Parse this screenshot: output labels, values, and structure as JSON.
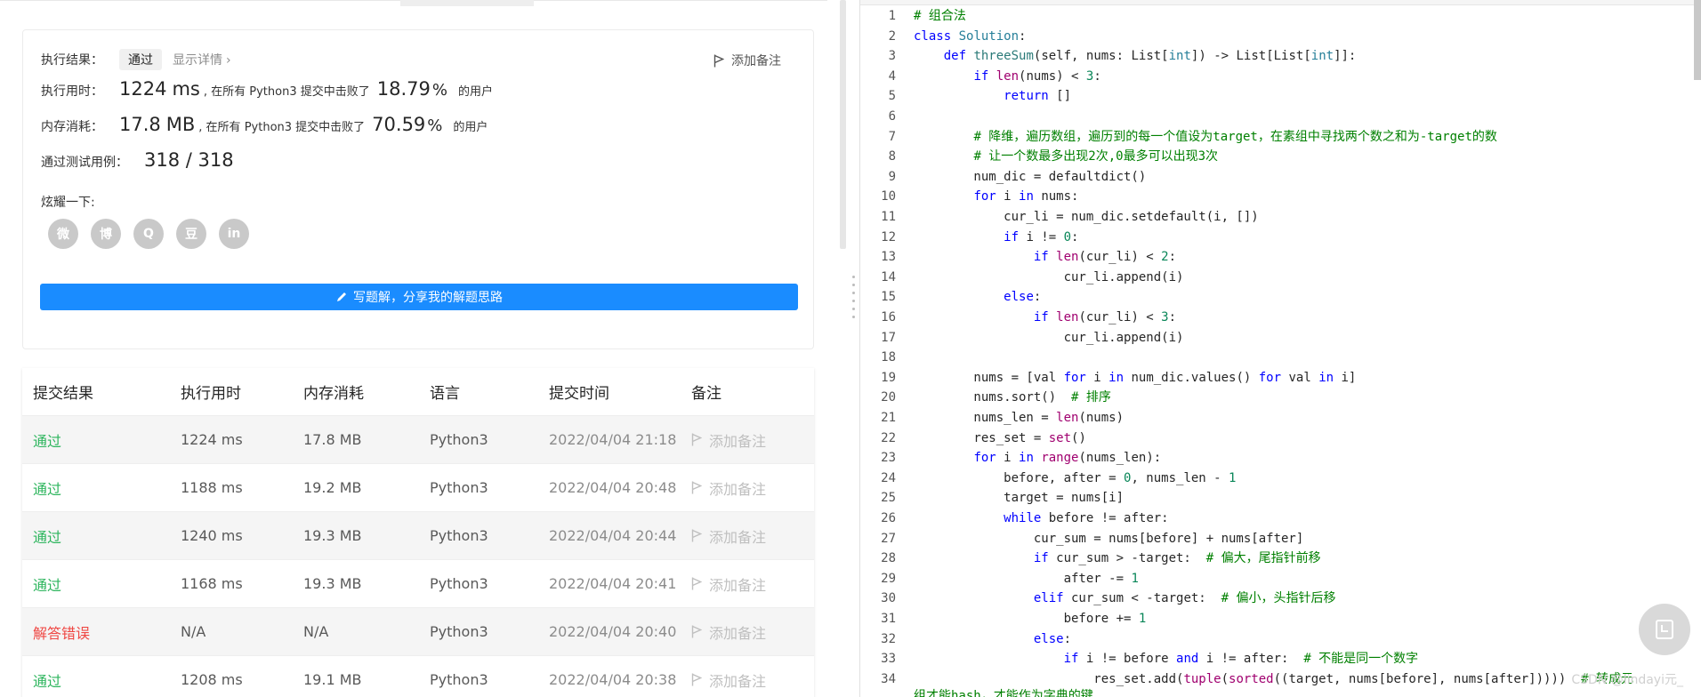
{
  "result": {
    "status_label": "执行结果：",
    "status_value": "通过",
    "detail_link": "显示详情",
    "detail_chevron": "›",
    "add_note": "添加备注",
    "runtime_label": "执行用时：",
    "runtime_value": "1224",
    "runtime_unit": "ms",
    "beat_prefix": ", 在所有 Python3 提交中击败了",
    "runtime_pct": "18.79",
    "pct_symbol": "%",
    "users_suffix": "的用户",
    "memory_label": "内存消耗：",
    "memory_value": "17.8",
    "memory_unit": "MB",
    "memory_pct": "70.59",
    "tests_label": "通过测试用例：",
    "tests_value": "318 / 318",
    "share_label": "炫耀一下:",
    "share_icons": [
      "wechat-icon",
      "weibo-icon",
      "qq-icon",
      "douban-icon",
      "linkedin-icon"
    ],
    "share_glyphs": [
      "微",
      "博",
      "Q",
      "豆",
      "in"
    ],
    "write_button": "写题解，分享我的解题思路"
  },
  "table": {
    "headers": [
      "提交结果",
      "执行用时",
      "内存消耗",
      "语言",
      "提交时间",
      "备注"
    ],
    "rows": [
      {
        "status": "通过",
        "ok": true,
        "time": "1224 ms",
        "memory": "17.8 MB",
        "lang": "Python3",
        "date": "2022/04/04 21:18",
        "note": "添加备注"
      },
      {
        "status": "通过",
        "ok": true,
        "time": "1188 ms",
        "memory": "19.2 MB",
        "lang": "Python3",
        "date": "2022/04/04 20:48",
        "note": "添加备注"
      },
      {
        "status": "通过",
        "ok": true,
        "time": "1240 ms",
        "memory": "19.3 MB",
        "lang": "Python3",
        "date": "2022/04/04 20:44",
        "note": "添加备注"
      },
      {
        "status": "通过",
        "ok": true,
        "time": "1168 ms",
        "memory": "19.3 MB",
        "lang": "Python3",
        "date": "2022/04/04 20:41",
        "note": "添加备注"
      },
      {
        "status": "解答错误",
        "ok": false,
        "time": "N/A",
        "memory": "N/A",
        "lang": "Python3",
        "date": "2022/04/04 20:40",
        "note": "添加备注"
      },
      {
        "status": "通过",
        "ok": true,
        "time": "1208 ms",
        "memory": "19.1 MB",
        "lang": "Python3",
        "date": "2022/04/04 20:38",
        "note": "添加备注"
      }
    ]
  },
  "colors": {
    "accent": "#1a8cff",
    "success": "#2db55d",
    "error": "#ef4743"
  },
  "editor": {
    "lines": [
      "# 组合法",
      "class Solution:",
      "    def threeSum(self, nums: List[int]) -> List[List[int]]:",
      "        if len(nums) < 3:",
      "            return []",
      "",
      "        # 降维，遍历数组，遍历到的每一个值设为target，在素组中寻找两个数之和为-target的数",
      "        # 让一个数最多出现2次,0最多可以出现3次",
      "        num_dic = defaultdict()",
      "        for i in nums:",
      "            cur_li = num_dic.setdefault(i, [])",
      "            if i != 0:",
      "                if len(cur_li) < 2:",
      "                    cur_li.append(i)",
      "            else:",
      "                if len(cur_li) < 3:",
      "                    cur_li.append(i)",
      "",
      "        nums = [val for i in num_dic.values() for val in i]",
      "        nums.sort()  # 排序",
      "        nums_len = len(nums)",
      "        res_set = set()",
      "        for i in range(nums_len):",
      "            before, after = 0, nums_len - 1",
      "            target = nums[i]",
      "            while before != after:",
      "                cur_sum = nums[before] + nums[after]",
      "                if cur_sum > -target:  # 偏大，尾指针前移",
      "                    after -= 1",
      "                elif cur_sum < -target:  # 偏小，头指针后移",
      "                    before += 1",
      "                else:",
      "                    if i != before and i != after:  # 不能是同一个数字",
      "                        res_set.add(tuple(sorted((target, nums[before], nums[after]))))  # 转成元"
    ],
    "wrap_continuation": "组才能hash，才能作为字典的键",
    "watermark": "CSDN @lindayi元_"
  }
}
